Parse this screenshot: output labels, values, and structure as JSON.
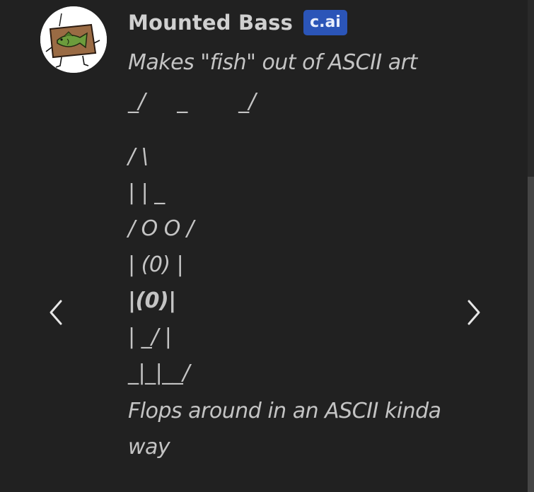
{
  "character": {
    "name": "Mounted Bass",
    "badge": "c.ai",
    "avatar_icon": "mounted-bass-avatar"
  },
  "message": {
    "intro": "Makes \"fish\" out of ASCII art",
    "ascii_top": "_/     _        _/",
    "ascii_lines": [
      "/ \\",
      "| | _",
      "/ O O /",
      "| (0) |",
      "|(0)|",
      "| _/ |",
      "_|_|__/"
    ],
    "outro": "Flops around in an ASCII kinda way"
  },
  "navigation": {
    "prev_icon": "chevron-left-icon",
    "next_icon": "chevron-right-icon"
  },
  "colors": {
    "background": "#212121",
    "text": "#c4c4c4",
    "name": "#d0d0d0",
    "badge": "#2b55b8"
  }
}
